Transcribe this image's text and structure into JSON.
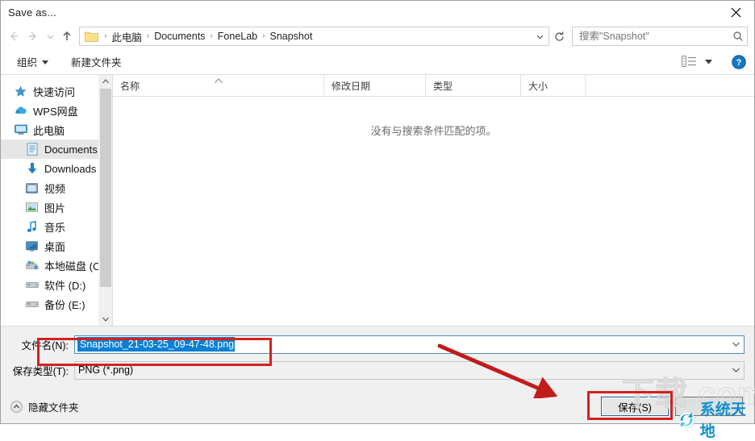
{
  "window": {
    "title": "Save as...",
    "close_label": "✕"
  },
  "address": {
    "back_icon": "back-arrow-icon",
    "forward_icon": "forward-arrow-icon",
    "recent_icon": "recent-locations-chevron-icon",
    "up_icon": "up-arrow-icon",
    "folder_icon": "folder-icon",
    "breadcrumbs": [
      "此电脑",
      "Documents",
      "FoneLab",
      "Snapshot"
    ],
    "separator": "›",
    "dropdown_icon": "chevron-down-icon",
    "refresh_icon": "refresh-icon"
  },
  "search": {
    "placeholder": "搜索\"Snapshot\"",
    "value": "",
    "icon": "search-icon"
  },
  "toolbar": {
    "organize_label": "组织",
    "organize_caret": "▼",
    "new_folder_label": "新建文件夹",
    "view_icon": "view-options-icon",
    "view_caret_icon": "chevron-down-icon",
    "help_icon": "help-icon"
  },
  "sidebar": {
    "items": [
      {
        "label": "快速访问",
        "icon": "star-pin-icon",
        "indent": false,
        "selected": false
      },
      {
        "label": "WPS网盘",
        "icon": "cloud-icon",
        "indent": false,
        "selected": false
      },
      {
        "label": "此电脑",
        "icon": "this-pc-icon",
        "indent": false,
        "selected": false
      },
      {
        "label": "Documents",
        "icon": "documents-icon",
        "indent": true,
        "selected": true
      },
      {
        "label": "Downloads",
        "icon": "downloads-icon",
        "indent": true,
        "selected": false
      },
      {
        "label": "视频",
        "icon": "videos-icon",
        "indent": true,
        "selected": false
      },
      {
        "label": "图片",
        "icon": "pictures-icon",
        "indent": true,
        "selected": false
      },
      {
        "label": "音乐",
        "icon": "music-icon",
        "indent": true,
        "selected": false
      },
      {
        "label": "桌面",
        "icon": "desktop-icon",
        "indent": true,
        "selected": false
      },
      {
        "label": "本地磁盘 (C:)",
        "icon": "system-drive-icon",
        "indent": true,
        "selected": false
      },
      {
        "label": "软件 (D:)",
        "icon": "drive-icon",
        "indent": true,
        "selected": false
      },
      {
        "label": "备份 (E:)",
        "icon": "drive-icon",
        "indent": true,
        "selected": false
      }
    ],
    "scroll_up_icon": "scroll-up-icon",
    "scroll_down_icon": "scroll-down-icon"
  },
  "filelist": {
    "columns": [
      {
        "label": "名称",
        "sorted": true
      },
      {
        "label": "修改日期",
        "sorted": false
      },
      {
        "label": "类型",
        "sorted": false
      },
      {
        "label": "大小",
        "sorted": false
      }
    ],
    "sort_caret": "^",
    "empty_message": "没有与搜索条件匹配的项。",
    "rows": []
  },
  "form": {
    "filename_label": "文件名(N):",
    "filename_value": "Snapshot_21-03-25_09-47-48.png",
    "filename_selected": true,
    "filetype_label": "保存类型(T):",
    "filetype_value": "PNG (*.png)",
    "dropdown_icon": "chevron-down-icon"
  },
  "footer": {
    "hide_folders_label": "隐藏文件夹",
    "hide_folders_icon": "chevron-up-circle-icon",
    "save_label": "保存(S)",
    "cancel_label": ""
  },
  "annotations": {
    "filename_box_color": "#d42020",
    "save_box_color": "#d42020",
    "arrow_color": "#c01c1c",
    "arrow_name": "red-pointer-arrow"
  },
  "watermark": {
    "outline_text": "下载.com",
    "logo_text": "系统天地",
    "logo_icon": "recycle-globe-icon",
    "logo_color": "#0c8fd0"
  }
}
